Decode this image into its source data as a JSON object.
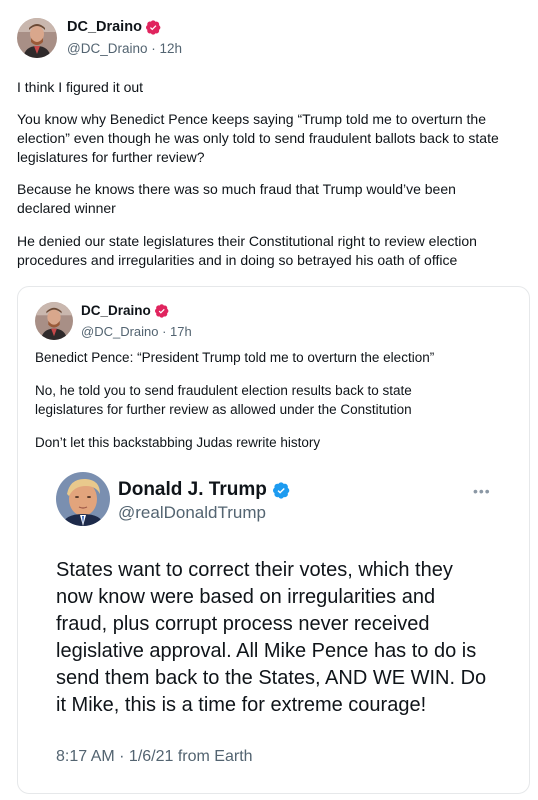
{
  "post": {
    "author_name": "DC_Draino",
    "author_handle": "@DC_Draino",
    "time": "12h",
    "handle_time": "@DC_Draino · 12h",
    "paragraphs": [
      "I think I figured it out",
      "You know why Benedict Pence keeps saying “Trump told me to overturn the election” even though he was only told to send fraudulent ballots back to state legislatures for further review?",
      "Because he knows there was so much fraud that Trump would’ve been declared winner",
      "He denied our state legislatures their Constitutional right to review election procedures and irregularities and in doing so betrayed his oath of office"
    ]
  },
  "quote": {
    "author_name": "DC_Draino",
    "handle_time": "@DC_Draino · 17h",
    "paragraphs": [
      "Benedict Pence: “President Trump told me to overturn the election”",
      "No, he told you to send fraudulent election results back to state legislatures for further review as allowed under the Constitution",
      "Don’t let this backstabbing Judas rewrite history"
    ]
  },
  "embedded": {
    "author_name": "Donald J. Trump",
    "author_handle": "@realDonaldTrump",
    "more_label": "•••",
    "lines": [
      "States want to correct their votes, which they",
      "now know were based on irregularities and",
      "fraud, plus corrupt process never received",
      "legislative approval.  All Mike Pence has to do is",
      "send them back to the States, AND WE WIN. Do",
      "it Mike, this is a time for extreme courage!"
    ],
    "footer": "8:17 AM · 1/6/21 from Earth"
  },
  "colors": {
    "badge_pink": "#e0245e",
    "badge_blue": "#1d9bf0",
    "muted_text": "#536471"
  },
  "icons": {
    "verified_pink": "verified-badge-icon",
    "verified_blue": "verified-badge-icon",
    "more": "more-options-icon"
  }
}
